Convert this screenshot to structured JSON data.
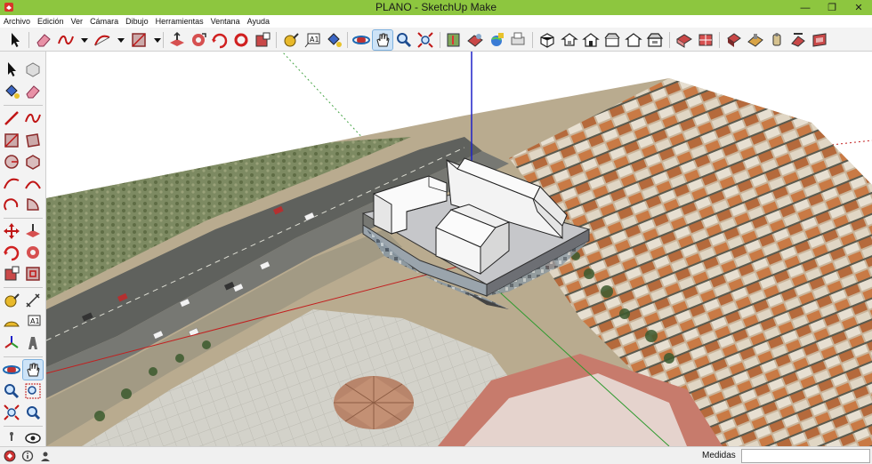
{
  "window": {
    "title": "PLANO - SketchUp Make",
    "minimize_glyph": "—",
    "maximize_glyph": "❐",
    "close_glyph": "✕"
  },
  "menu": [
    "Archivo",
    "Edición",
    "Ver",
    "Cámara",
    "Dibujo",
    "Herramientas",
    "Ventana",
    "Ayuda"
  ],
  "toolbar_icons": [
    "select-icon",
    "eraser-icon",
    "freehand-icon",
    "arc-icon",
    "rectangle-icon",
    "push-pull-icon",
    "follow-me-icon",
    "rotate-icon",
    "scale-icon",
    "tape-measure-icon",
    "text-icon",
    "paint-bucket-icon",
    "orbit-icon",
    "pan-icon",
    "zoom-icon",
    "zoom-extents-icon",
    "add-location-icon",
    "photo-textures-icon",
    "preview-google-earth-icon",
    "print-icon",
    "iso-view-icon",
    "top-view-icon",
    "front-view-icon",
    "right-view-icon",
    "back-view-icon",
    "left-view-icon",
    "xray-icon",
    "wireframe-icon",
    "hidden-line-icon",
    "shaded-icon",
    "shaded-textures-icon",
    "monochrome-icon"
  ],
  "left_tool_icons": [
    "select-icon",
    "component-icon",
    "paint-bucket-icon",
    "eraser-icon",
    "line-icon",
    "freehand-icon",
    "rectangle-icon",
    "rotated-rectangle-icon",
    "circle-icon",
    "polygon-icon",
    "arc-icon",
    "two-point-arc-icon",
    "three-point-arc-icon",
    "pie-icon",
    "move-icon",
    "push-pull-icon",
    "rotate-icon",
    "follow-me-icon",
    "scale-icon",
    "offset-icon",
    "tape-measure-icon",
    "dimension-icon",
    "protractor-icon",
    "text-icon",
    "axes-icon",
    "3d-text-icon",
    "orbit-icon",
    "pan-icon",
    "zoom-icon",
    "zoom-window-icon",
    "zoom-extents-icon",
    "previous-view-icon",
    "position-camera-icon",
    "look-around-icon"
  ],
  "status": {
    "measurements_label": "Medidas",
    "measurements_value": "",
    "status_icons": [
      "geolocation-icon",
      "credits-icon",
      "user-icon"
    ]
  },
  "colors": {
    "title_bar": "#8dc63f",
    "blue_axis": "#1f22c9",
    "red_axis": "#c21f1f",
    "green_axis": "#2f9a2f",
    "toolbar_bg": "#f3f3f3"
  }
}
